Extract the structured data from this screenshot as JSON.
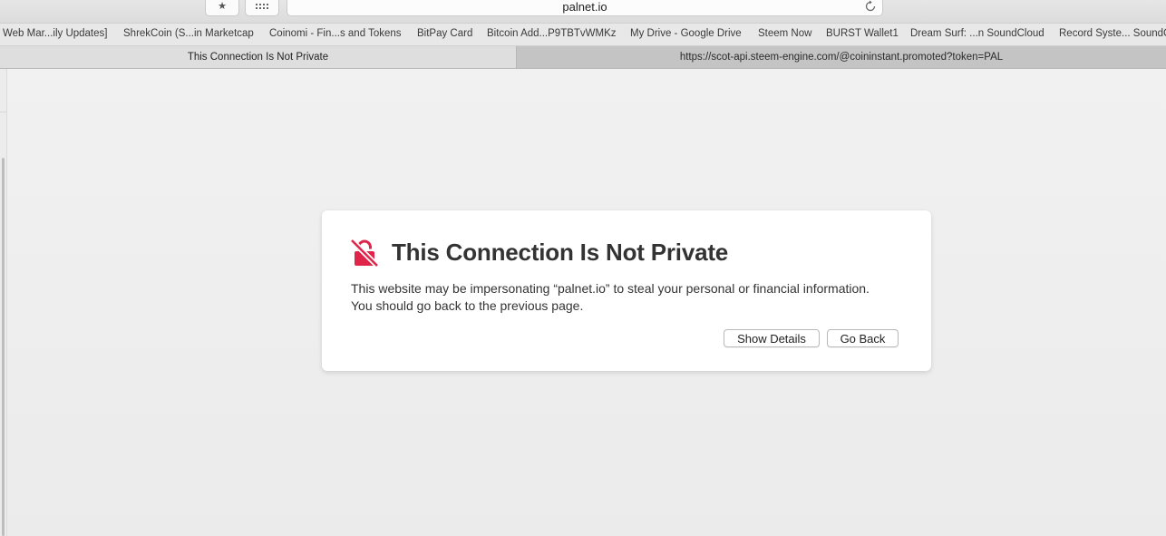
{
  "toolbar": {
    "bookmark_icon": "star-icon",
    "grid_icon": "grid-icon",
    "url": "palnet.io",
    "reload_icon": "reload-icon"
  },
  "bookmarks": [
    "Web Mar...ily Updates]",
    "ShrekCoin (S...in Marketcap",
    "Coinomi - Fin...s and Tokens",
    "BitPay Card",
    "Bitcoin Add...P9TBTvWMKz",
    "My Drive - Google Drive",
    "Steem Now",
    "BURST Wallet1",
    "Dream Surf: ...n SoundCloud",
    "Record Syste... SoundCloud"
  ],
  "tabs": [
    {
      "label": "This Connection Is Not Private",
      "active": true
    },
    {
      "label": "https://scot-api.steem-engine.com/@coininstant.promoted?token=PAL",
      "active": false
    }
  ],
  "warning": {
    "icon": "broken-lock-icon",
    "icon_color": "#e0254a",
    "title": "This Connection Is Not Private",
    "body_line1": "This website may be impersonating “palnet.io” to steal your personal or financial information.",
    "body_line2": "You should go back to the previous page.",
    "details_button": "Show Details",
    "back_button": "Go Back"
  }
}
